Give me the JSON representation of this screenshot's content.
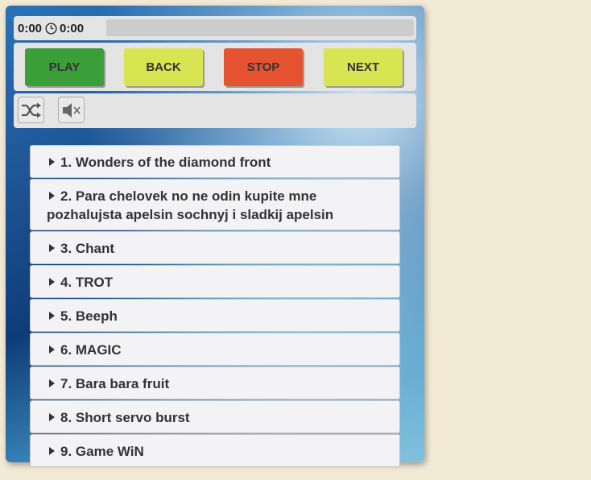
{
  "player": {
    "current_time": "0:00",
    "total_time": "0:00",
    "icons": {
      "clock": "clock-icon",
      "shuffle": "shuffle-icon",
      "mute": "mute-icon"
    }
  },
  "controls": {
    "play_label": "PLAY",
    "back_label": "BACK",
    "stop_label": "STOP",
    "next_label": "NEXT"
  },
  "colors": {
    "play": "#3a9f38",
    "back": "#d8e451",
    "stop": "#e55331",
    "next": "#d8e451",
    "page_background": "#f3ead6"
  },
  "playlist": [
    {
      "label": "1. Wonders of the diamond front"
    },
    {
      "label": "2. Para chelovek no ne odin kupite mne pozhalujsta apelsin sochnyj i sladkij apelsin"
    },
    {
      "label": "3. Chant"
    },
    {
      "label": "4. TROT"
    },
    {
      "label": "5. Beeph"
    },
    {
      "label": "6. MAGIC"
    },
    {
      "label": "7. Bara bara fruit"
    },
    {
      "label": "8. Short servo burst"
    },
    {
      "label": "9. Game WiN"
    }
  ]
}
